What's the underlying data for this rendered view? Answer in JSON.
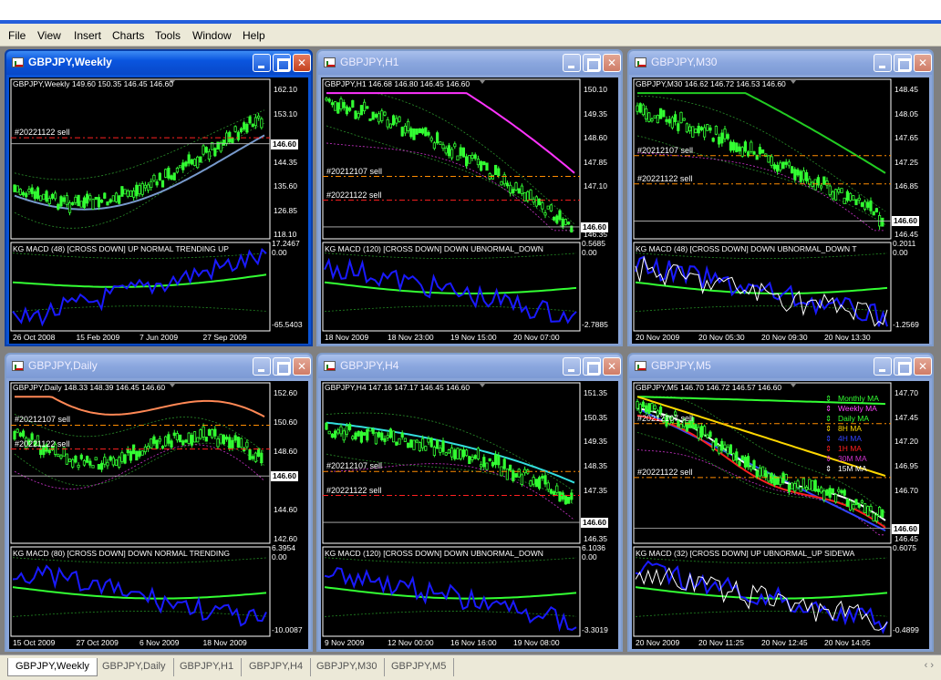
{
  "menu": [
    "File",
    "View",
    "Insert",
    "Charts",
    "Tools",
    "Window",
    "Help"
  ],
  "windows": [
    {
      "title": "GBPJPY,Weekly",
      "active": true,
      "header": "GBPJPY,Weekly  149.60 150.35 146.45 146.60",
      "yticks": [
        "162.10",
        "153.10",
        "146.60",
        "144.35",
        "135.60",
        "126.85",
        "118.10"
      ],
      "current_price": "146.60",
      "order_labels": [
        "#20221122 sell"
      ],
      "macd": {
        "label": "KG MACD (48)  [CROSS DOWN]  UP NORMAL  TRENDING UP",
        "top": "17.2467",
        "zero": "0.00",
        "bottom": "-65.5403"
      },
      "xticks": [
        "26 Oct 2008",
        "15 Feb 2009",
        "7 Jun 2009",
        "27 Sep 2009"
      ]
    },
    {
      "title": "GBPJPY,H1",
      "active": false,
      "header": "GBPJPY,H1  146.68 146.80 146.45 146.60",
      "yticks": [
        "150.10",
        "149.35",
        "148.60",
        "147.85",
        "147.10",
        "146.60",
        "146.35"
      ],
      "current_price": "146.60",
      "order_labels": [
        "#20212107 sell",
        "#20221122 sell"
      ],
      "macd": {
        "label": "KG MACD (120)  [CROSS DOWN]  DOWN  UBNORMAL_DOWN",
        "top": "0.5685",
        "zero": "0.00",
        "bottom": "-2.7885"
      },
      "xticks": [
        "18 Nov 2009",
        "18 Nov 23:00",
        "19 Nov 15:00",
        "20 Nov 07:00"
      ]
    },
    {
      "title": "GBPJPY,M30",
      "active": false,
      "header": "GBPJPY,M30  146.62 146.72 146.53 146.60",
      "yticks": [
        "148.45",
        "148.05",
        "147.65",
        "147.25",
        "146.85",
        "146.60",
        "146.45"
      ],
      "current_price": "146.60",
      "order_labels": [
        "#20212107 sell",
        "#20221122 sell"
      ],
      "macd": {
        "label": "KG MACD (48)  [CROSS DOWN]  DOWN  UBNORMAL_DOWN  T",
        "top": "0.2011",
        "zero": "0.00",
        "bottom": "-1.2569"
      },
      "xticks": [
        "20 Nov 2009",
        "20 Nov 05:30",
        "20 Nov 09:30",
        "20 Nov 13:30"
      ]
    },
    {
      "title": "GBPJPY,Daily",
      "active": false,
      "header": "GBPJPY,Daily  148.33 148.39 146.45 146.60",
      "yticks": [
        "152.60",
        "150.60",
        "148.60",
        "146.60",
        "144.60",
        "142.60"
      ],
      "current_price": "146.60",
      "order_labels": [
        "#20212107 sell",
        "#20221122 sell"
      ],
      "macd": {
        "label": "KG MACD (80)  [CROSS DOWN]  DOWN  NORMAL  TRENDING",
        "top": "6.3954",
        "zero": "0.00",
        "bottom": "-10.0087"
      },
      "xticks": [
        "15 Oct 2009",
        "27 Oct 2009",
        "6 Nov 2009",
        "18 Nov 2009"
      ]
    },
    {
      "title": "GBPJPY,H4",
      "active": false,
      "header": "GBPJPY,H4  147.16 147.17 146.45 146.60",
      "yticks": [
        "151.35",
        "150.35",
        "149.35",
        "148.35",
        "147.35",
        "146.60",
        "146.35"
      ],
      "current_price": "146.60",
      "order_labels": [
        "#20212107 sell",
        "#20221122 sell"
      ],
      "macd": {
        "label": "KG MACD (120)  [CROSS DOWN]  DOWN  UBNORMAL_DOWN",
        "top": "6.1036",
        "zero": "0.00",
        "bottom": "-3.3019"
      },
      "xticks": [
        "9 Nov 2009",
        "12 Nov 00:00",
        "16 Nov 16:00",
        "19 Nov 08:00"
      ]
    },
    {
      "title": "GBPJPY,M5",
      "active": false,
      "header": "GBPJPY,M5  146.70 146.72 146.57 146.60",
      "yticks": [
        "147.70",
        "147.45",
        "147.20",
        "146.95",
        "146.70",
        "146.60",
        "146.45"
      ],
      "current_price": "146.60",
      "order_labels": [
        "#20212107 sell",
        "#20221122 sell"
      ],
      "legend": [
        {
          "label": "Monthly MA",
          "color": "#33ff33"
        },
        {
          "label": "Weekly MA",
          "color": "#ff44ff"
        },
        {
          "label": "Daily MA",
          "color": "#33ff33"
        },
        {
          "label": "8H MA",
          "color": "#ffd700"
        },
        {
          "label": "4H MA",
          "color": "#3344ff"
        },
        {
          "label": "1H MA",
          "color": "#ff2020"
        },
        {
          "label": "30M MA",
          "color": "#cc33cc"
        },
        {
          "label": "15M MA",
          "color": "#ffffff"
        }
      ],
      "macd": {
        "label": "KG MACD (32)  [CROSS DOWN]  UP  UBNORMAL_UP  SIDEWA",
        "top": "0.6075",
        "zero": "",
        "bottom": "-0.4899"
      },
      "xticks": [
        "20 Nov 2009",
        "20 Nov 11:25",
        "20 Nov 12:45",
        "20 Nov 14:05"
      ]
    }
  ],
  "tabs": [
    "GBPJPY,Weekly",
    "GBPJPY,Daily",
    "GBPJPY,H1",
    "GBPJPY,H4",
    "GBPJPY,M30",
    "GBPJPY,M5"
  ],
  "active_tab": "GBPJPY,Weekly",
  "colors": {
    "candle": "#33ff33",
    "macd_main": "#1a1aff",
    "macd_signal": "#33ff33",
    "sell_line": "#ff2020",
    "order_line": "#ff8c00"
  }
}
